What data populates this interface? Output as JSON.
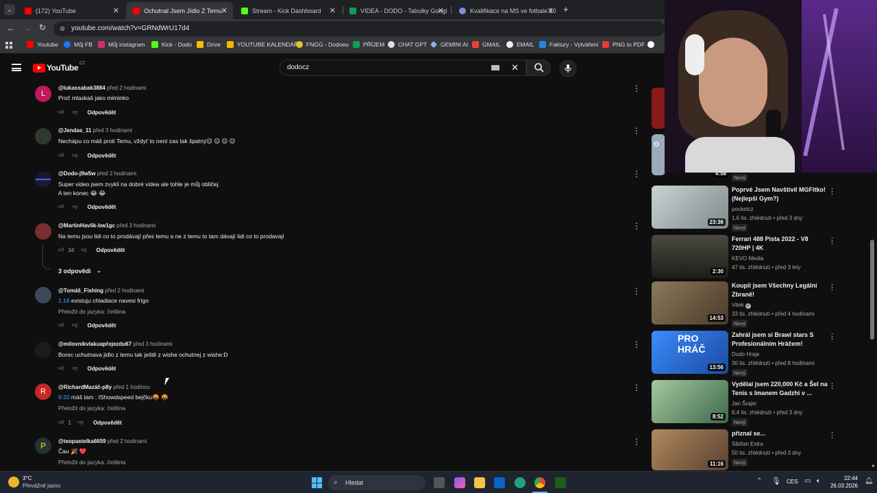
{
  "browser": {
    "tabs": [
      {
        "title": "(172) YouTube",
        "active": false
      },
      {
        "title": "Ochutnal Jsem Jídlo Z Temu - ",
        "active": true
      },
      {
        "title": "Stream - Kick Dashboard",
        "active": false
      },
      {
        "title": "VIDEA - DODO - Tabulky Googl",
        "active": false
      },
      {
        "title": "Kvalifikace na MS ve fotbale 20",
        "active": false
      }
    ],
    "new_tab": "+",
    "url": "youtube.com/watch?v=GRNdWrU17d4",
    "bookmarks": [
      "Youtube",
      "Můj FB",
      "Můj instagram",
      "Kick - Dodo",
      "Drive",
      "YOUTUBE KALENDÁŘ",
      "FNGG - Dodoeu",
      "PŘÍJEM",
      "CHAT GPT",
      "GEMINI AI",
      "GMAIL",
      "EMAIL",
      "Faktury - Vytváření",
      "PNG to PDF"
    ]
  },
  "youtube": {
    "logo": "YouTube",
    "region": "CZ",
    "search_value": "dodocz"
  },
  "comments": [
    {
      "user": "@lukassabak3884",
      "time": "před 2 hodinami",
      "lines": [
        "Proč mlaskaš jako miminko"
      ],
      "likes": "",
      "reply": "Odpovědět",
      "avatar_letter": "L",
      "avatar_color": "#c2185b"
    },
    {
      "user": "@Jendas_11",
      "time": "před 3 hodinami",
      "lines": [
        "Nechápu co máš proti Temu, vždyť to není zas tak špatný😐 😐 😐 😐"
      ],
      "likes": "",
      "reply": "Odpovědět",
      "avatar_letter": "",
      "avatar_color": "#2d3a2d"
    },
    {
      "user": "@Dodo-j9w5w",
      "time": "před 2 hodinami",
      "lines": [
        "Super video jsem zvykli na dobré videa ale tohle je můj obličej.",
        "A ten konec 😂 😂"
      ],
      "likes": "",
      "reply": "Odpovědět",
      "avatar_letter": "",
      "avatar_color": "#1a1a2e"
    },
    {
      "user": "@MartinHavlik-bw1gc",
      "time": "před 3 hodinami",
      "lines": [
        "Na temu jsou lidi co to prodávají přes temu a ne z temu to tam dávají lidi co to prodavají"
      ],
      "likes": "34",
      "reply": "Odpovědět",
      "avatar_letter": "",
      "avatar_color": "#7a3030",
      "replies_label": "3 odpovědi"
    },
    {
      "user": "@Tomáš_Fishing",
      "time": "před 2 hodinami",
      "timestamp": "1:18",
      "lines": [
        " existuju chladiace navesi frigo"
      ],
      "translate": "Přeložit do jazyka: čeština",
      "likes": "",
      "reply": "Odpovědět",
      "avatar_letter": "",
      "avatar_color": "#3a4a5a"
    },
    {
      "user": "@milovnikvlakuapřejezdu67",
      "time": "před 3 hodinami",
      "lines": [
        "Borec uchutnava jidlo z temu tak ještě z wishe ochutnej z wishe:D"
      ],
      "likes": "",
      "reply": "Odpovědět",
      "avatar_letter": "",
      "avatar_color": "#1c1c1c"
    },
    {
      "user": "@RichardMazáč-p8y",
      "time": "před 1 hodinou",
      "timestamp": "9:20",
      "lines": [
        " máš tam : IShowdspeed bejčku🤬 🤬"
      ],
      "translate": "Přeložit do jazyka: čeština",
      "likes": "1",
      "reply": "Odpovědět",
      "avatar_letter": "R",
      "avatar_color": "#c62828"
    },
    {
      "user": "@teopastelka6659",
      "time": "před 2 hodinami",
      "lines": [
        "Čau 🎉 ❤️"
      ],
      "translate": "Přeložit do jazyka: čeština",
      "likes": "",
      "reply": "Odpovědět",
      "avatar_letter": "",
      "avatar_color": "#233"
    }
  ],
  "related": [
    {
      "title": "",
      "channel": "",
      "meta": "",
      "duration": "4:58",
      "badge": "Nový",
      "thumb_color": "#8b1a1a"
    },
    {
      "title": "Poprvé Jsem Navštívil MGFitko! (Nejlepší Gym?)",
      "channel": "pocketcz",
      "meta": "1,6 tis. zhlédnutí • před 3 dny",
      "duration": "23:36",
      "badge": "Nový",
      "thumb_color": "#9aa6a8"
    },
    {
      "title": "Ferrari 488 Pista 2022 - V8 720HP | 4K",
      "channel": "KEVO Media",
      "meta": "47 tis. zhlédnutí • před 3 lety",
      "duration": "2:30",
      "badge": "",
      "thumb_color": "#2e2e2a"
    },
    {
      "title": "Koupil jsem Všechny Legální Zbraně!",
      "channel": "Vitek",
      "meta": "33 tis. zhlédnutí • před 4 hodinami",
      "duration": "14:53",
      "badge": "Nový",
      "thumb_color": "#6b5a3a",
      "verified": true
    },
    {
      "title": "Zahrál jsem si Brawl stars S Profesionálním Hráčem!",
      "channel": "Dodo Hraje",
      "meta": "30 tis. zhlédnutí • před 8 hodinami",
      "duration": "13:56",
      "badge": "Nový",
      "thumb_color": "#2a67c9"
    },
    {
      "title": "Vydělal jsem 220,000 Kč a Šel na Tenis s Imanem Gadzhi v ...",
      "channel": "Jan Šrajer",
      "meta": "8,4 tis. zhlédnutí • před 3 dny",
      "duration": "8:52",
      "badge": "Nový",
      "thumb_color": "#5b8a66"
    },
    {
      "title": "přiznal se...",
      "channel": "Sibiřan Extra",
      "meta": "50 tis. zhlédnutí • před 3 dny",
      "duration": "11:16",
      "badge": "Nový",
      "thumb_color": "#8a6a4a"
    }
  ],
  "taskbar": {
    "temp": "3°C",
    "weather": "Převážně jasno",
    "search_placeholder": "Hledat",
    "lang": "CES",
    "time": "22:44",
    "date": "26.03.2026"
  }
}
